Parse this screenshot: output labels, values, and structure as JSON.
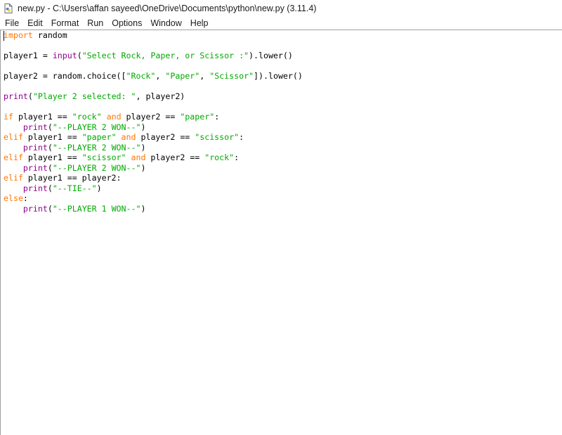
{
  "window": {
    "title": "new.py - C:\\Users\\affan sayeed\\OneDrive\\Documents\\python\\new.py (3.11.4)",
    "icon": "python-file-icon"
  },
  "menu": {
    "items": [
      "File",
      "Edit",
      "Format",
      "Run",
      "Options",
      "Window",
      "Help"
    ]
  },
  "editor": {
    "colors": {
      "keyword": "#ff7700",
      "builtin": "#900090",
      "string": "#00aa00",
      "default": "#000000"
    },
    "lines": [
      [
        {
          "t": "import",
          "c": "kw"
        },
        {
          "t": " random",
          "c": ""
        }
      ],
      [],
      [
        {
          "t": "player1 = ",
          "c": ""
        },
        {
          "t": "input",
          "c": "bi"
        },
        {
          "t": "(",
          "c": ""
        },
        {
          "t": "\"Select Rock, Paper, or Scissor :\"",
          "c": "st"
        },
        {
          "t": ").lower()",
          "c": ""
        }
      ],
      [],
      [
        {
          "t": "player2 = random.choice([",
          "c": ""
        },
        {
          "t": "\"Rock\"",
          "c": "st"
        },
        {
          "t": ", ",
          "c": ""
        },
        {
          "t": "\"Paper\"",
          "c": "st"
        },
        {
          "t": ", ",
          "c": ""
        },
        {
          "t": "\"Scissor\"",
          "c": "st"
        },
        {
          "t": "]).lower()",
          "c": ""
        }
      ],
      [],
      [
        {
          "t": "print",
          "c": "bi"
        },
        {
          "t": "(",
          "c": ""
        },
        {
          "t": "\"Player 2 selected: \"",
          "c": "st"
        },
        {
          "t": ", player2)",
          "c": ""
        }
      ],
      [],
      [
        {
          "t": "if",
          "c": "kw"
        },
        {
          "t": " player1 == ",
          "c": ""
        },
        {
          "t": "\"rock\"",
          "c": "st"
        },
        {
          "t": " ",
          "c": ""
        },
        {
          "t": "and",
          "c": "kw"
        },
        {
          "t": " player2 == ",
          "c": ""
        },
        {
          "t": "\"paper\"",
          "c": "st"
        },
        {
          "t": ":",
          "c": ""
        }
      ],
      [
        {
          "t": "    ",
          "c": ""
        },
        {
          "t": "print",
          "c": "bi"
        },
        {
          "t": "(",
          "c": ""
        },
        {
          "t": "\"--PLAYER 2 WON--\"",
          "c": "st"
        },
        {
          "t": ")",
          "c": ""
        }
      ],
      [
        {
          "t": "elif",
          "c": "kw"
        },
        {
          "t": " player1 == ",
          "c": ""
        },
        {
          "t": "\"paper\"",
          "c": "st"
        },
        {
          "t": " ",
          "c": ""
        },
        {
          "t": "and",
          "c": "kw"
        },
        {
          "t": " player2 == ",
          "c": ""
        },
        {
          "t": "\"scissor\"",
          "c": "st"
        },
        {
          "t": ":",
          "c": ""
        }
      ],
      [
        {
          "t": "    ",
          "c": ""
        },
        {
          "t": "print",
          "c": "bi"
        },
        {
          "t": "(",
          "c": ""
        },
        {
          "t": "\"--PLAYER 2 WON--\"",
          "c": "st"
        },
        {
          "t": ")",
          "c": ""
        }
      ],
      [
        {
          "t": "elif",
          "c": "kw"
        },
        {
          "t": " player1 == ",
          "c": ""
        },
        {
          "t": "\"scissor\"",
          "c": "st"
        },
        {
          "t": " ",
          "c": ""
        },
        {
          "t": "and",
          "c": "kw"
        },
        {
          "t": " player2 == ",
          "c": ""
        },
        {
          "t": "\"rock\"",
          "c": "st"
        },
        {
          "t": ":",
          "c": ""
        }
      ],
      [
        {
          "t": "    ",
          "c": ""
        },
        {
          "t": "print",
          "c": "bi"
        },
        {
          "t": "(",
          "c": ""
        },
        {
          "t": "\"--PLAYER 2 WON--\"",
          "c": "st"
        },
        {
          "t": ")",
          "c": ""
        }
      ],
      [
        {
          "t": "elif",
          "c": "kw"
        },
        {
          "t": " player1 == player2:",
          "c": ""
        }
      ],
      [
        {
          "t": "    ",
          "c": ""
        },
        {
          "t": "print",
          "c": "bi"
        },
        {
          "t": "(",
          "c": ""
        },
        {
          "t": "\"--TIE--\"",
          "c": "st"
        },
        {
          "t": ")",
          "c": ""
        }
      ],
      [
        {
          "t": "else",
          "c": "kw"
        },
        {
          "t": ":",
          "c": ""
        }
      ],
      [
        {
          "t": "    ",
          "c": ""
        },
        {
          "t": "print",
          "c": "bi"
        },
        {
          "t": "(",
          "c": ""
        },
        {
          "t": "\"--PLAYER 1 WON--\"",
          "c": "st"
        },
        {
          "t": ")",
          "c": ""
        }
      ]
    ]
  }
}
